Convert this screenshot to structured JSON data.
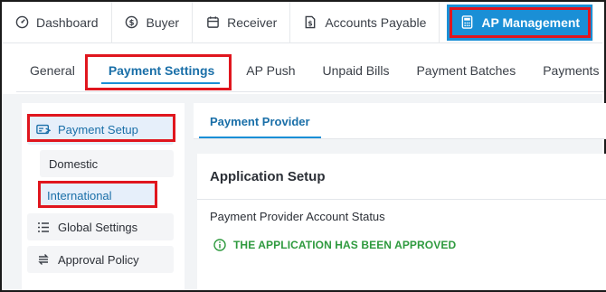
{
  "top_nav": {
    "items": [
      {
        "label": "Dashboard",
        "icon": "dashboard-gauge-icon"
      },
      {
        "label": "Buyer",
        "icon": "dollar-circle-icon"
      },
      {
        "label": "Receiver",
        "icon": "calendar-icon"
      },
      {
        "label": "Accounts Payable",
        "icon": "dollar-document-icon"
      },
      {
        "label": "AP Management",
        "icon": "calculator-icon",
        "active": true
      }
    ]
  },
  "sub_tabs": {
    "items": [
      {
        "label": "General"
      },
      {
        "label": "Payment Settings",
        "active": true
      },
      {
        "label": "AP Push"
      },
      {
        "label": "Unpaid Bills"
      },
      {
        "label": "Payment Batches"
      },
      {
        "label": "Payments"
      }
    ]
  },
  "sidebar": {
    "payment_setup": "Payment Setup",
    "domestic": "Domestic",
    "international": "International",
    "global_settings": "Global Settings",
    "approval_policy": "Approval Policy"
  },
  "main": {
    "provider_tab": "Payment Provider",
    "card_title": "Application Setup",
    "status_label": "Payment Provider Account Status",
    "status_value": "THE APPLICATION HAS BEEN APPROVED"
  },
  "colors": {
    "accent": "#1a8fd6",
    "highlight": "#e0161e",
    "success": "#2e9a3e"
  }
}
